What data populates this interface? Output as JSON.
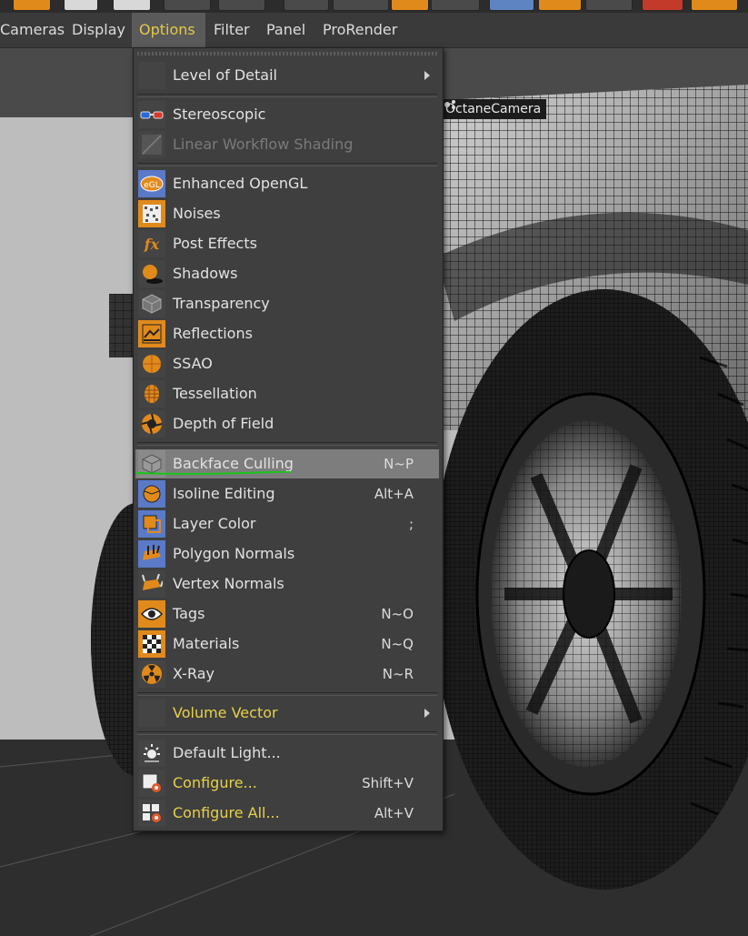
{
  "menubar": {
    "items": [
      {
        "label": "Cameras"
      },
      {
        "label": "Display"
      },
      {
        "label": "Options"
      },
      {
        "label": "Filter"
      },
      {
        "label": "Panel"
      },
      {
        "label": "ProRender"
      }
    ],
    "active": "Options"
  },
  "viewport": {
    "camera_label": "OctaneCamera"
  },
  "menu": {
    "items": [
      {
        "label": "Level of Detail",
        "icon": "blank-icon",
        "submenu": true
      },
      {
        "label": "Stereoscopic",
        "icon": "stereo-glasses-icon"
      },
      {
        "label": "Linear Workflow Shading",
        "icon": "linear-workflow-icon",
        "disabled": true
      },
      {
        "label": "Enhanced OpenGL",
        "icon": "opengl-icon"
      },
      {
        "label": "Noises",
        "icon": "noise-icon"
      },
      {
        "label": "Post Effects",
        "icon": "fx-icon"
      },
      {
        "label": "Shadows",
        "icon": "shadow-icon"
      },
      {
        "label": "Transparency",
        "icon": "transparency-cube-icon"
      },
      {
        "label": "Reflections",
        "icon": "reflection-icon"
      },
      {
        "label": "SSAO",
        "icon": "ssao-sphere-icon"
      },
      {
        "label": "Tessellation",
        "icon": "tessellation-icon"
      },
      {
        "label": "Depth of Field",
        "icon": "aperture-icon"
      },
      {
        "label": "Backface Culling",
        "shortcut": "N~P",
        "icon": "backface-cube-icon",
        "highlighted": true
      },
      {
        "label": "Isoline Editing",
        "shortcut": "Alt+A",
        "icon": "isoline-icon"
      },
      {
        "label": "Layer Color",
        "shortcut": ";",
        "icon": "layer-color-icon"
      },
      {
        "label": "Polygon Normals",
        "icon": "polygon-normals-icon"
      },
      {
        "label": "Vertex Normals",
        "icon": "vertex-normals-icon"
      },
      {
        "label": "Tags",
        "shortcut": "N~O",
        "icon": "eye-icon"
      },
      {
        "label": "Materials",
        "shortcut": "N~Q",
        "icon": "checker-material-icon"
      },
      {
        "label": "X-Ray",
        "shortcut": "N~R",
        "icon": "radiation-icon"
      },
      {
        "label": "Volume Vector",
        "icon": "blank-icon",
        "submenu": true,
        "yellow": true
      },
      {
        "label": "Default Light...",
        "icon": "light-icon"
      },
      {
        "label": "Configure...",
        "shortcut": "Shift+V",
        "icon": "configure-icon",
        "yellow": true
      },
      {
        "label": "Configure All...",
        "shortcut": "Alt+V",
        "icon": "configure-all-icon",
        "yellow": true
      }
    ]
  },
  "colors": {
    "menu_bg": "#3f3f3f",
    "highlight": "#7d7d7d",
    "accent_orange": "#e08a1c",
    "active_menu_text": "#e6c84a",
    "annotation_green": "#17c617"
  }
}
